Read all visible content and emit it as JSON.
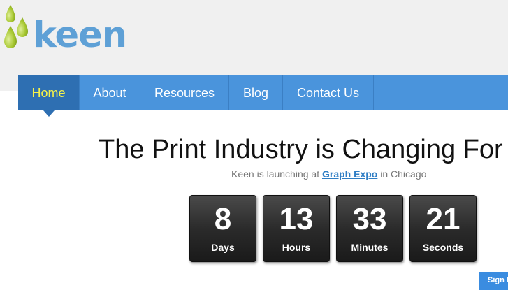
{
  "brand": {
    "name": "keen",
    "drop_colors": [
      "#9bbd2a",
      "#b6d23e"
    ],
    "text_color": "#5ea0d6"
  },
  "nav": {
    "items": [
      {
        "label": "Home",
        "active": true
      },
      {
        "label": "About"
      },
      {
        "label": "Resources"
      },
      {
        "label": "Blog"
      },
      {
        "label": "Contact Us"
      }
    ],
    "bg_color": "#4a94dc",
    "active_color": "#2e6fb2",
    "active_text_color": "#f5f14a"
  },
  "hero": {
    "headline": "The Print Industry is Changing For",
    "sub_prefix": "Keen is launching at ",
    "sub_link": "Graph Expo",
    "sub_suffix": " in Chicago"
  },
  "countdown": [
    {
      "value": "8",
      "label": "Days"
    },
    {
      "value": "13",
      "label": "Hours"
    },
    {
      "value": "33",
      "label": "Minutes"
    },
    {
      "value": "21",
      "label": "Seconds"
    }
  ],
  "signup": {
    "label": "Sign Up"
  }
}
